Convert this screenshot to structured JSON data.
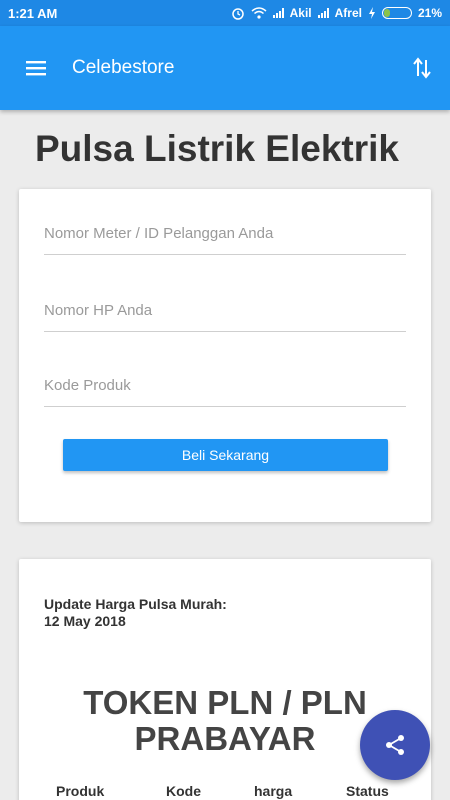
{
  "status_bar": {
    "time": "1:21 AM",
    "carrier1": "Akil",
    "carrier2": "Afrel",
    "battery": "21%",
    "icons": [
      "alarm-icon",
      "wifi-icon",
      "signal-icon",
      "charging-icon",
      "battery-icon"
    ]
  },
  "app_bar": {
    "title": "Celebestore",
    "menu_icon": "hamburger-menu-icon",
    "action_icon": "swap-vertical-icon",
    "color": "#2196f3"
  },
  "page": {
    "title": "Pulsa Listrik Elektrik"
  },
  "form": {
    "meter_placeholder": "Nomor Meter / ID Pelanggan Anda",
    "phone_placeholder": "Nomor HP Anda",
    "product_placeholder": "Kode Produk",
    "submit_label": "Beli Sekarang"
  },
  "price": {
    "update_label": "Update Harga Pulsa Murah:",
    "update_date": "12 May 2018",
    "section_title_line1": "TOKEN PLN / PLN",
    "section_title_line2": "PRABAYAR",
    "columns": [
      "Produk",
      "Kode",
      "harga",
      "Status"
    ]
  },
  "fab": {
    "icon": "share-icon",
    "color": "#3f51b5"
  }
}
